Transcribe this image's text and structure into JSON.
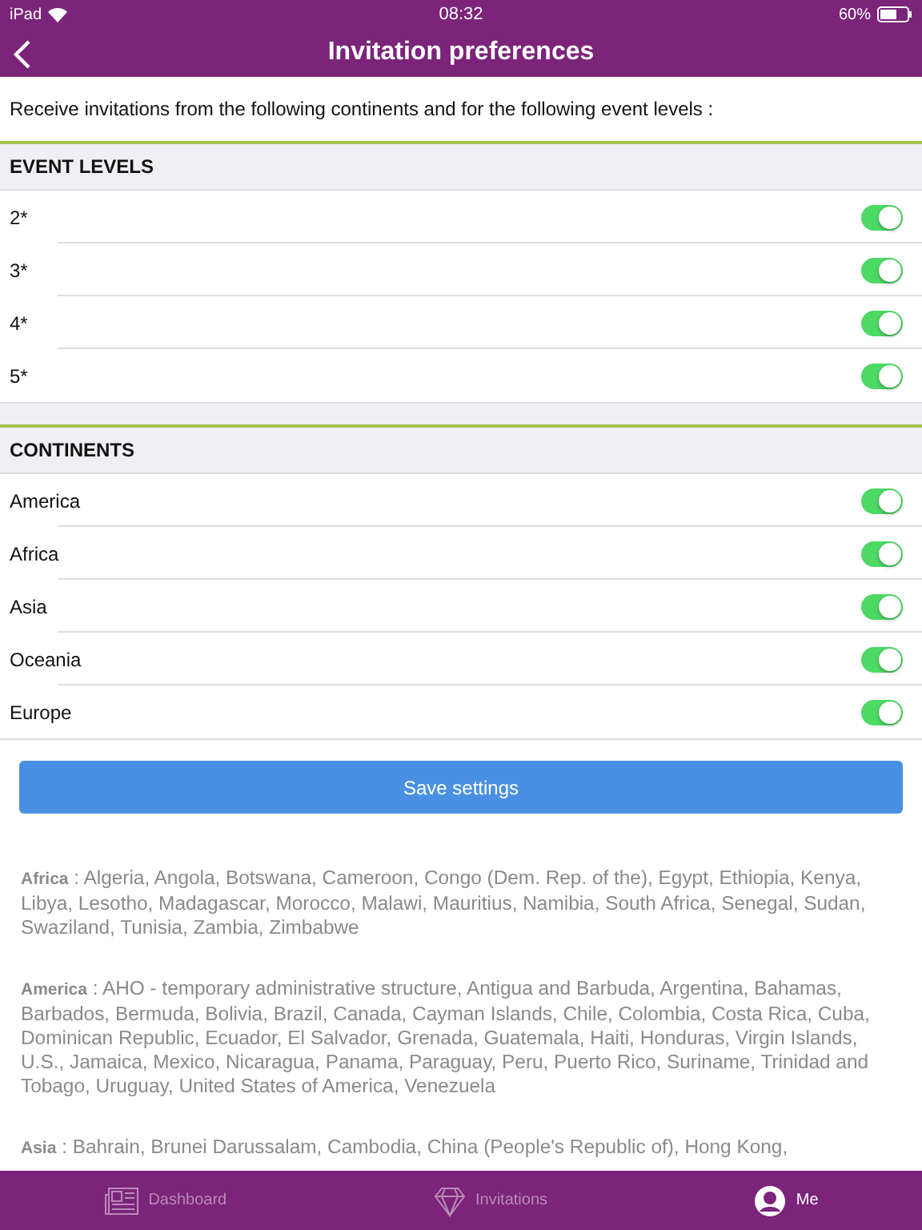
{
  "status_bar": {
    "device": "iPad",
    "time": "08:32",
    "battery": "60%"
  },
  "nav": {
    "title": "Invitation preferences"
  },
  "intro": "Receive invitations from the following continents and for the following event levels :",
  "sections": [
    {
      "title": "EVENT LEVELS",
      "items": [
        {
          "label": "2*",
          "on": true
        },
        {
          "label": "3*",
          "on": true
        },
        {
          "label": "4*",
          "on": true
        },
        {
          "label": "5*",
          "on": true
        }
      ]
    },
    {
      "title": "CONTINENTS",
      "items": [
        {
          "label": "America",
          "on": true
        },
        {
          "label": "Africa",
          "on": true
        },
        {
          "label": "Asia",
          "on": true
        },
        {
          "label": "Oceania",
          "on": true
        },
        {
          "label": "Europe",
          "on": true
        }
      ]
    }
  ],
  "save_button": "Save settings",
  "countries": [
    {
      "continent": "Africa",
      "text": " : Algeria, Angola, Botswana, Cameroon, Congo (Dem. Rep. of the), Egypt, Ethiopia, Kenya, Libya, Lesotho, Madagascar, Morocco, Malawi, Mauritius, Namibia, South Africa, Senegal, Sudan, Swaziland, Tunisia, Zambia, Zimbabwe"
    },
    {
      "continent": "America",
      "text": " : AHO - temporary administrative structure, Antigua and Barbuda, Argentina, Bahamas, Barbados, Bermuda, Bolivia, Brazil, Canada, Cayman Islands, Chile, Colombia, Costa Rica, Cuba, Dominican Republic, Ecuador, El Salvador, Grenada, Guatemala, Haiti, Honduras, Virgin Islands, U.S., Jamaica, Mexico, Nicaragua, Panama, Paraguay, Peru, Puerto Rico, Suriname, Trinidad and Tobago, Uruguay, United States of America, Venezuela"
    },
    {
      "continent": "Asia",
      "text": " : Bahrain, Brunei Darussalam, Cambodia, China (People's Republic of), Hong Kong,"
    }
  ],
  "tabs": [
    {
      "label": "Dashboard",
      "selected": false
    },
    {
      "label": "Invitations",
      "selected": false
    },
    {
      "label": "Me",
      "selected": true
    }
  ]
}
